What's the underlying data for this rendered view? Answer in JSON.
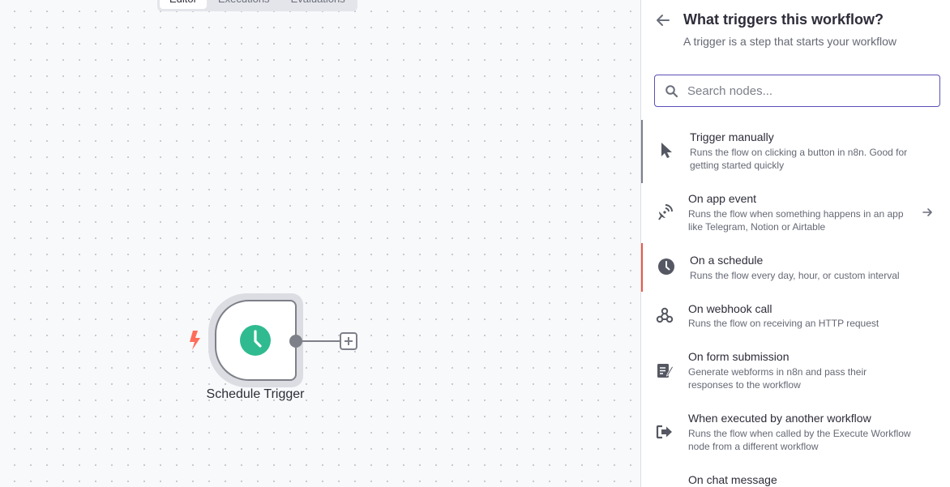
{
  "canvas": {
    "tabs": [
      {
        "label": "Editor"
      },
      {
        "label": "Executions"
      },
      {
        "label": "Evaluations"
      }
    ],
    "node": {
      "label": "Schedule Trigger",
      "icon": "clock-icon",
      "color": "#2fbb8f"
    },
    "trigger_icon_color": "#ff6d5a"
  },
  "panel": {
    "title": "What triggers this workflow?",
    "subtitle": "A trigger is a step that starts your workflow",
    "search": {
      "placeholder": "Search nodes...",
      "value": ""
    },
    "items": [
      {
        "title": "Trigger manually",
        "desc": "Runs the flow on clicking a button in n8n. Good for getting started quickly",
        "icon": "cursor-icon"
      },
      {
        "title": "On app event",
        "desc": "Runs the flow when something happens in an app like Telegram, Notion or Airtable",
        "icon": "satellite-icon"
      },
      {
        "title": "On a schedule",
        "desc": "Runs the flow every day, hour, or custom interval",
        "icon": "clock-icon"
      },
      {
        "title": "On webhook call",
        "desc": "Runs the flow on receiving an HTTP request",
        "icon": "webhook-icon"
      },
      {
        "title": "On form submission",
        "desc": "Generate webforms in n8n and pass their responses to the workflow",
        "icon": "form-icon"
      },
      {
        "title": "When executed by another workflow",
        "desc": "Runs the flow when called by the Execute Workflow node from a different workflow",
        "icon": "sign-in-icon"
      },
      {
        "title": "On chat message",
        "desc": "",
        "icon": "chat-icon"
      }
    ],
    "accent_color": "#5b4fb8",
    "highlight_color": "#ea5a4c"
  }
}
